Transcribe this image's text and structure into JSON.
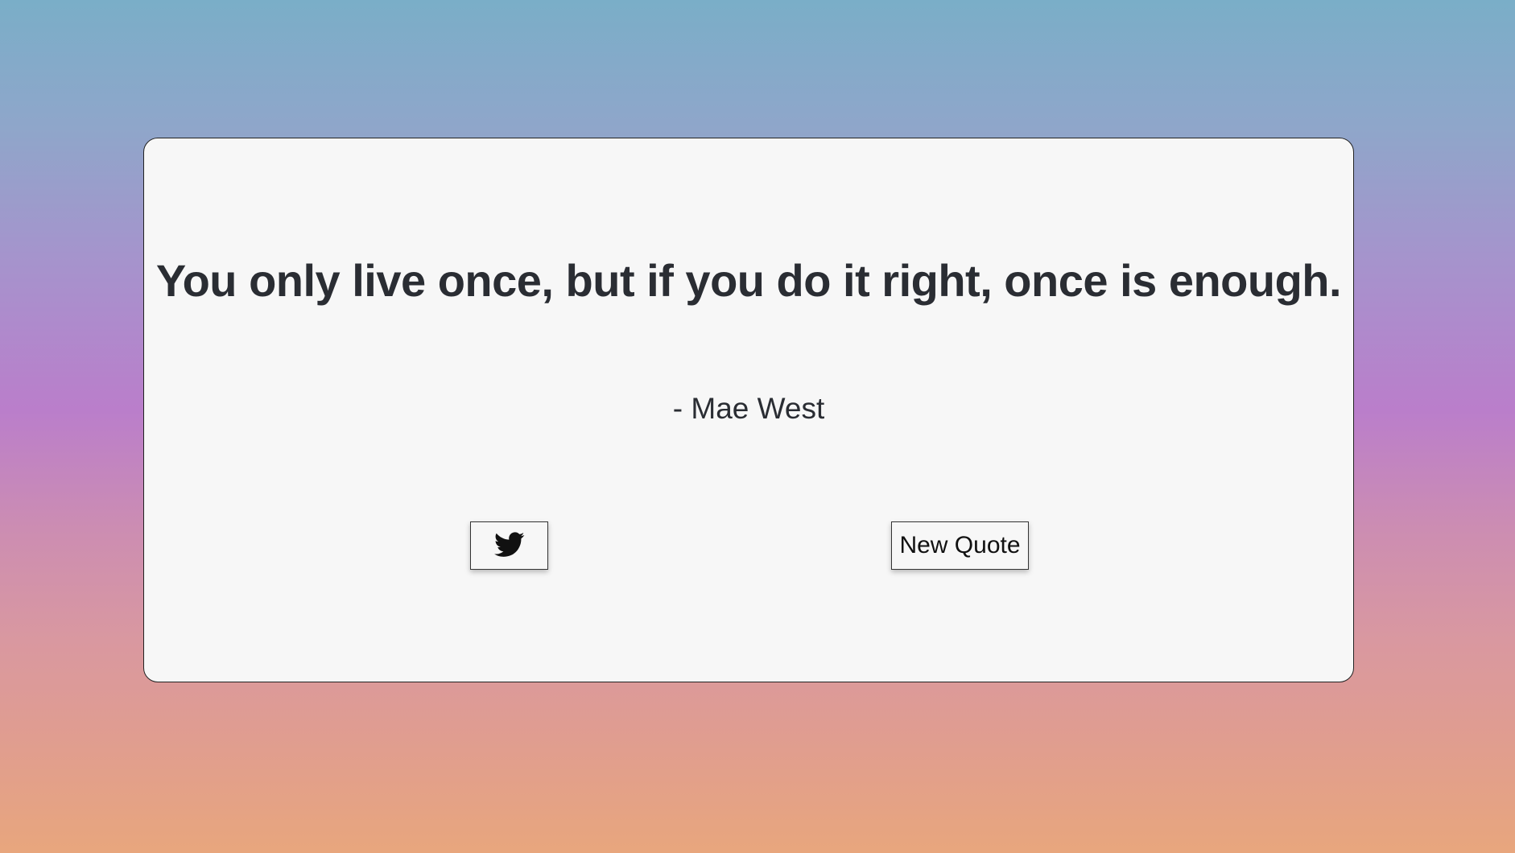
{
  "quote": {
    "text": "You only live once, but if you do it right, once is enough.",
    "author": "- Mae West"
  },
  "buttons": {
    "tweet_icon": "twitter-icon",
    "new_quote_label": "New Quote"
  }
}
